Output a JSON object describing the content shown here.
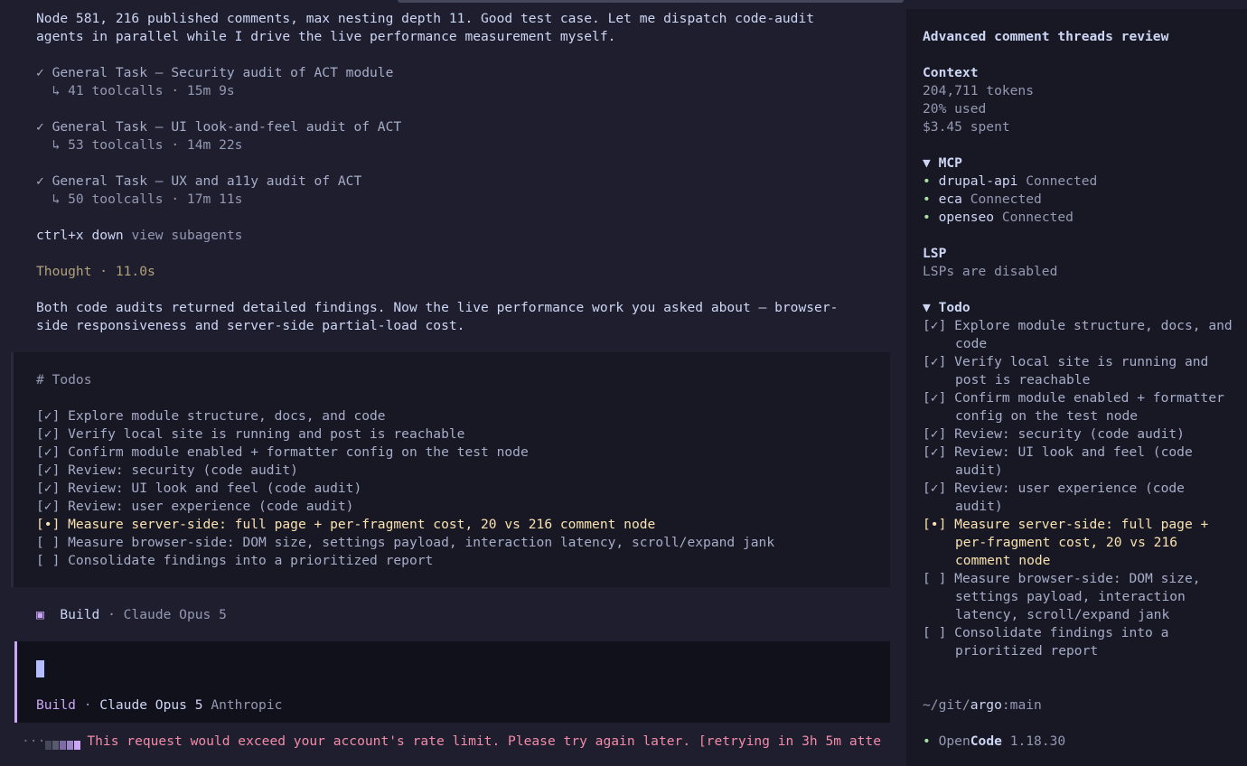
{
  "transcript": {
    "intro": [
      "Node 581, 216 published comments, max nesting depth 11. Good test case. Let me dispatch code-audit",
      "agents in parallel while I drive the live performance measurement myself."
    ],
    "tasks": [
      {
        "title": "✓ General Task — Security audit of ACT module",
        "meta": "  ↳ 41 toolcalls · 15m 9s"
      },
      {
        "title": "✓ General Task — UI look-and-feel audit of ACT",
        "meta": "  ↳ 53 toolcalls · 14m 22s"
      },
      {
        "title": "✓ General Task — UX and a11y audit of ACT",
        "meta": "  ↳ 50 toolcalls · 17m 11s"
      }
    ],
    "subagents_key": "ctrl+x down",
    "subagents_label": " view subagents",
    "thought": "Thought · 11.0s",
    "summary": [
      "Both code audits returned detailed findings. Now the live performance work you asked about — browser-",
      "side responsiveness and server-side partial-load cost."
    ]
  },
  "todos_block": {
    "heading": "# Todos",
    "items": [
      {
        "text": "[✓] Explore module structure, docs, and code",
        "status": "done"
      },
      {
        "text": "[✓] Verify local site is running and post is reachable",
        "status": "done"
      },
      {
        "text": "[✓] Confirm module enabled + formatter config on the test node",
        "status": "done"
      },
      {
        "text": "[✓] Review: security (code audit)",
        "status": "done"
      },
      {
        "text": "[✓] Review: UI look and feel (code audit)",
        "status": "done"
      },
      {
        "text": "[✓] Review: user experience (code audit)",
        "status": "done"
      },
      {
        "text": "[•] Measure server-side: full page + per-fragment cost, 20 vs 216 comment node",
        "status": "active"
      },
      {
        "text": "[ ] Measure browser-side: DOM size, settings payload, interaction latency, scroll/expand jank",
        "status": "pending"
      },
      {
        "text": "[ ] Consolidate findings into a prioritized report",
        "status": "pending"
      }
    ]
  },
  "build_row": {
    "icon": "▣",
    "mode": "Build",
    "sep": " · ",
    "model": "Claude Opus 5"
  },
  "input": {
    "mode": "Build",
    "sep": " · ",
    "model": "Claude Opus 5",
    "provider": " Anthropic"
  },
  "status": {
    "dots": "···",
    "message": "This request would exceed your account's rate limit. Please try again later. [retrying in 3h 5m atte"
  },
  "sidebar": {
    "title": "Advanced comment threads review",
    "context": {
      "heading": "Context",
      "tokens": "204,711 tokens",
      "used": "20% used",
      "spent": "$3.45 spent"
    },
    "mcp": {
      "heading": "▼ MCP",
      "servers": [
        {
          "name": "drupal-api",
          "status": " Connected"
        },
        {
          "name": "eca",
          "status": " Connected"
        },
        {
          "name": "openseo",
          "status": " Connected"
        }
      ]
    },
    "lsp": {
      "heading": "LSP",
      "text": "LSPs are disabled"
    },
    "todo": {
      "heading": "▼ Todo",
      "items": [
        {
          "mark": "[✓]",
          "text": "Explore module structure, docs, and code",
          "status": "done"
        },
        {
          "mark": "[✓]",
          "text": "Verify local site is running and post is reachable",
          "status": "done"
        },
        {
          "mark": "[✓]",
          "text": "Confirm module enabled + formatter config on the test node",
          "status": "done"
        },
        {
          "mark": "[✓]",
          "text": "Review: security (code audit)",
          "status": "done"
        },
        {
          "mark": "[✓]",
          "text": "Review: UI look and feel (code audit)",
          "status": "done"
        },
        {
          "mark": "[✓]",
          "text": "Review: user experience (code audit)",
          "status": "done"
        },
        {
          "mark": "[•]",
          "text": "Measure server-side: full page + per-fragment cost, 20 vs 216 comment node",
          "status": "active"
        },
        {
          "mark": "[ ]",
          "text": "Measure browser-side: DOM size, settings payload, interaction latency, scroll/expand jank",
          "status": "pending"
        },
        {
          "mark": "[ ]",
          "text": "Consolidate findings into a prioritized report",
          "status": "pending"
        }
      ]
    },
    "path_prefix": "~/git/",
    "path_repo": "argo",
    "path_branch": ":main",
    "brand_open": "Open",
    "brand_code": "Code",
    "version": " 1.18.30"
  },
  "colors": {
    "accent": "#cba6f7",
    "active": "#f9e2af",
    "error": "#f38ba8",
    "connected": "#a6e3a1"
  }
}
